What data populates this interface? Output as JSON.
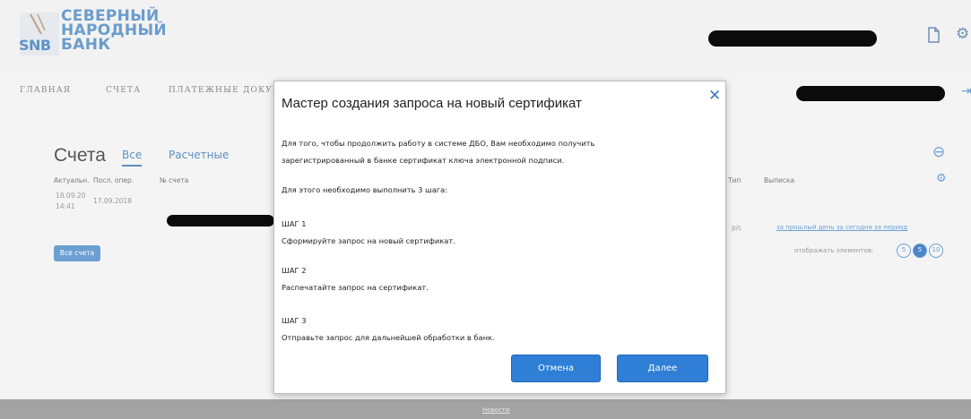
{
  "logo": {
    "abbr": "SNB",
    "line1": "СЕВЕРНЫЙ",
    "line2": "НАРОДНЫЙ",
    "line3": "БАНК"
  },
  "header": {
    "icons": [
      "document-icon",
      "gear-icon"
    ]
  },
  "nav": {
    "items": [
      "ГЛАВНАЯ",
      "СЧЕТА",
      "ПЛАТЕЖНЫЕ ДОКУМЕНТЫ"
    ]
  },
  "accounts": {
    "title": "Счета",
    "tabs": [
      "Все",
      "Расчетные"
    ],
    "columns": {
      "actual": "Актуальн.",
      "last_op": "Посл. опер.",
      "number": "№ счета",
      "type": "Тип",
      "statement": "Выписка"
    },
    "row": {
      "actual_date": "18.09.20",
      "actual_time": "14:41",
      "last_op": "17.09.2018",
      "type": "р/с"
    },
    "links": {
      "prev_day": "за прошлый день",
      "today": "за сегодня",
      "period": "за период"
    },
    "all_button": "Все счета",
    "per_page_label": "отображать элементов:",
    "per_page_options": [
      "5",
      "5",
      "10"
    ]
  },
  "footer": {
    "news": "Новости"
  },
  "modal": {
    "title": "Мастер создания запроса на новый сертификат",
    "intro_line1": "Для того, чтобы продолжить работу в системе ДБО, Вам необходимо получить",
    "intro_line2": "зарегистрированный в банке сертификат ключа электронной подписи.",
    "steps_intro": "Для этого необходимо выполнить 3 шага:",
    "step1_label": "ШАГ 1",
    "step1_text": "Сформируйте запрос на новый сертификат.",
    "step2_label": "ШАГ 2",
    "step2_text": "Распечатайте запрос на сертификат.",
    "step3_label": "ШАГ 3",
    "step3_text": "Отправьте запрос для дальнейшей обработки в банк.",
    "cancel_button": "Отмена",
    "next_button": "Далее"
  },
  "colors": {
    "accent": "#2f7fd6",
    "logo_blue": "#6a9ccd",
    "footer": "#a3a3a3"
  }
}
